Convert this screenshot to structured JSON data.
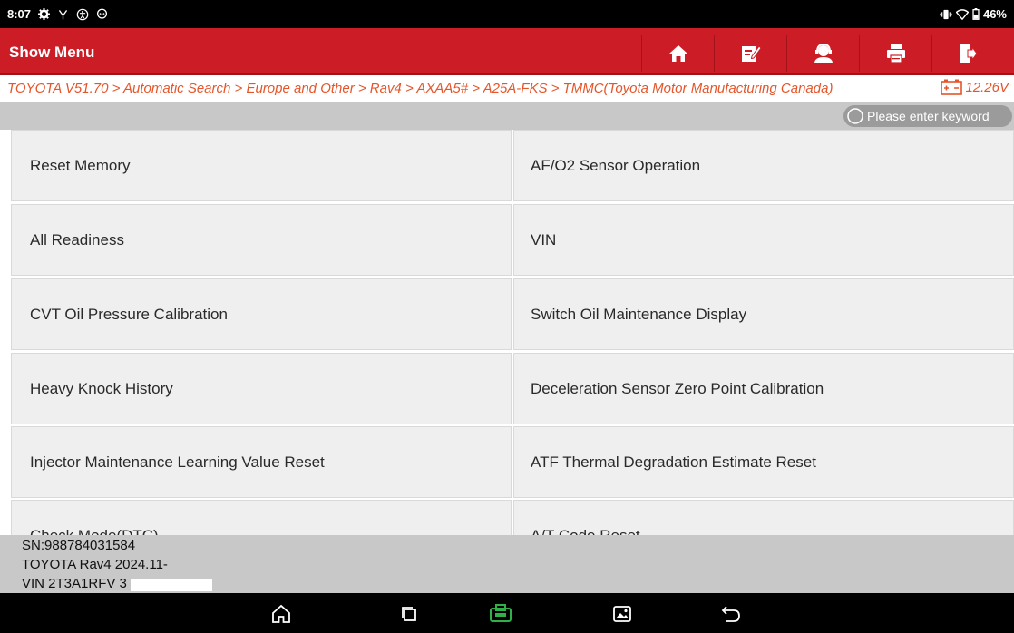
{
  "status_bar": {
    "time": "8:07",
    "battery": "46%",
    "icons_left": [
      "settings-icon",
      "usb-icon",
      "accessibility-icon",
      "chat-icon"
    ],
    "icons_right": [
      "vibrate-icon",
      "wifi-icon",
      "battery-icon"
    ]
  },
  "header": {
    "title": "Show Menu",
    "tools": [
      "home-icon",
      "edit-report-icon",
      "support-icon",
      "print-icon",
      "exit-icon"
    ]
  },
  "breadcrumb": {
    "path": "TOYOTA V51.70 > Automatic Search > Europe and Other > Rav4 > AXAA5# > A25A-FKS > TMMC(Toyota Motor Manufacturing Canada)",
    "voltage": "12.26V"
  },
  "search": {
    "placeholder": "Please enter keyword"
  },
  "menu_items": [
    {
      "label": "Reset Memory"
    },
    {
      "label": "AF/O2 Sensor Operation"
    },
    {
      "label": "All Readiness"
    },
    {
      "label": "VIN"
    },
    {
      "label": "CVT Oil Pressure Calibration"
    },
    {
      "label": "Switch Oil Maintenance Display"
    },
    {
      "label": "Heavy Knock History"
    },
    {
      "label": "Deceleration Sensor Zero Point Calibration"
    },
    {
      "label": "Injector Maintenance Learning Value Reset"
    },
    {
      "label": "ATF Thermal Degradation Estimate Reset"
    },
    {
      "label": "Check Mode(DTC)"
    },
    {
      "label": "A/T Code Reset"
    }
  ],
  "info": {
    "sn": "SN:988784031584",
    "vehicle": "TOYOTA Rav4 2024.11-",
    "vin": "VIN 2T3A1RFV          3"
  },
  "nav_bar": {
    "buttons": [
      "home-nav-icon",
      "recent-apps-icon",
      "vci-icon",
      "screenshot-icon",
      "back-icon"
    ],
    "vci_color": "#2fb14a"
  },
  "colors": {
    "header_red": "#cc1d27",
    "breadcrumb_orange": "#e5552a",
    "panel_gray": "#c8c8c8",
    "cell_gray": "#efefef"
  }
}
